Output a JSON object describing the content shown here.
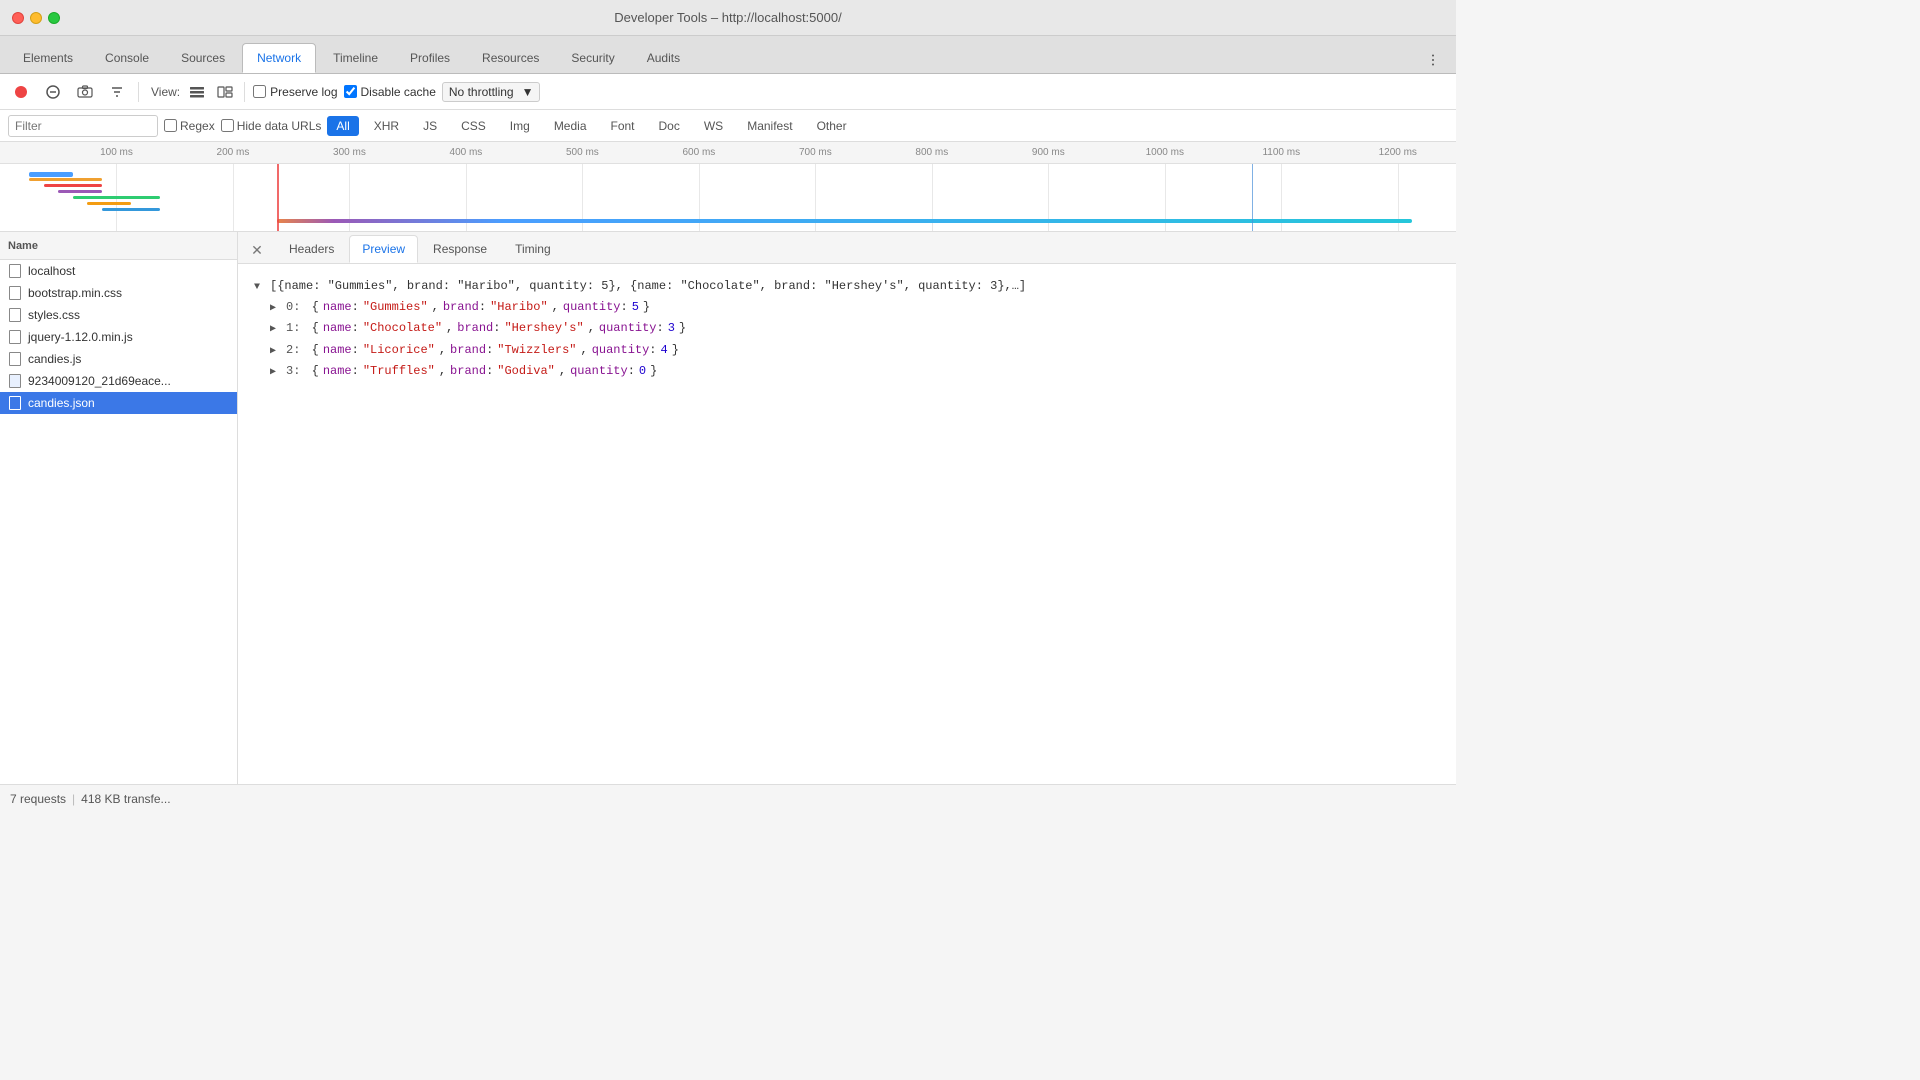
{
  "titleBar": {
    "title": "Developer Tools – http://localhost:5000/",
    "trafficLights": [
      "close",
      "minimize",
      "maximize"
    ]
  },
  "navTabs": {
    "items": [
      {
        "label": "Elements",
        "active": false
      },
      {
        "label": "Console",
        "active": false
      },
      {
        "label": "Sources",
        "active": false
      },
      {
        "label": "Network",
        "active": true
      },
      {
        "label": "Timeline",
        "active": false
      },
      {
        "label": "Profiles",
        "active": false
      },
      {
        "label": "Resources",
        "active": false
      },
      {
        "label": "Security",
        "active": false
      },
      {
        "label": "Audits",
        "active": false
      }
    ]
  },
  "toolbar": {
    "viewLabel": "View:",
    "preserveLog": {
      "label": "Preserve log",
      "checked": false
    },
    "disableCache": {
      "label": "Disable cache",
      "checked": true
    },
    "throttle": {
      "label": "No throttling"
    }
  },
  "filterBar": {
    "placeholder": "Filter",
    "regex": {
      "label": "Regex",
      "checked": false
    },
    "hideDataUrls": {
      "label": "Hide data URLs",
      "checked": false
    },
    "types": [
      {
        "label": "All",
        "active": true
      },
      {
        "label": "XHR",
        "active": false
      },
      {
        "label": "JS",
        "active": false
      },
      {
        "label": "CSS",
        "active": false
      },
      {
        "label": "Img",
        "active": false
      },
      {
        "label": "Media",
        "active": false
      },
      {
        "label": "Font",
        "active": false
      },
      {
        "label": "Doc",
        "active": false
      },
      {
        "label": "WS",
        "active": false
      },
      {
        "label": "Manifest",
        "active": false
      },
      {
        "label": "Other",
        "active": false
      }
    ]
  },
  "timeline": {
    "rulers": [
      {
        "label": "100 ms",
        "pos": 8
      },
      {
        "label": "200 ms",
        "pos": 15
      },
      {
        "label": "300 ms",
        "pos": 22
      },
      {
        "label": "400 ms",
        "pos": 31
      },
      {
        "label": "500 ms",
        "pos": 38
      },
      {
        "label": "600 ms",
        "pos": 46
      },
      {
        "label": "700 ms",
        "pos": 54
      },
      {
        "label": "800 ms",
        "pos": 61
      },
      {
        "label": "900 ms",
        "pos": 69
      },
      {
        "label": "1000 ms",
        "pos": 76
      },
      {
        "label": "1100 ms",
        "pos": 84
      },
      {
        "label": "1200 ms",
        "pos": 91
      }
    ]
  },
  "fileList": {
    "header": "Name",
    "items": [
      {
        "name": "localhost",
        "type": "doc",
        "selected": false
      },
      {
        "name": "bootstrap.min.css",
        "type": "css",
        "selected": false
      },
      {
        "name": "styles.css",
        "type": "css",
        "selected": false
      },
      {
        "name": "jquery-1.12.0.min.js",
        "type": "js",
        "selected": false
      },
      {
        "name": "candies.js",
        "type": "js",
        "selected": false
      },
      {
        "name": "9234009120_21d69eace...",
        "type": "img",
        "selected": false
      },
      {
        "name": "candies.json",
        "type": "json",
        "selected": true
      }
    ]
  },
  "detailPanel": {
    "tabs": [
      {
        "label": "Headers",
        "active": false
      },
      {
        "label": "Preview",
        "active": true
      },
      {
        "label": "Response",
        "active": false
      },
      {
        "label": "Timing",
        "active": false
      }
    ],
    "preview": {
      "summaryLine": "[{name: \"Gummies\", brand: \"Haribo\", quantity: 5}, {name: \"Chocolate\", brand: \"Hershey's\", quantity: 3},…]",
      "items": [
        {
          "index": "0",
          "name": "Gummies",
          "brand": "Haribo",
          "quantity": 5
        },
        {
          "index": "1",
          "name": "Chocolate",
          "brand": "Hershey's",
          "quantity": 3
        },
        {
          "index": "2",
          "name": "Licorice",
          "brand": "Twizzlers",
          "quantity": 4
        },
        {
          "index": "3",
          "name": "Truffles",
          "brand": "Godiva",
          "quantity": 0
        }
      ]
    }
  },
  "statusBar": {
    "requests": "7 requests",
    "separator": "|",
    "transfer": "418 KB transfe..."
  }
}
